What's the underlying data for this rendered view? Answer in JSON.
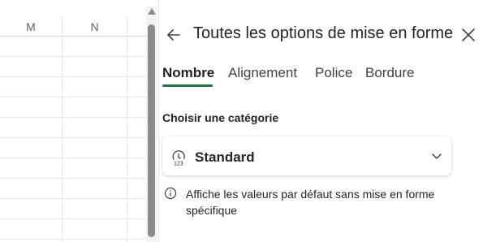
{
  "grid": {
    "columns": [
      "M",
      "N"
    ]
  },
  "pane": {
    "title": "Toutes les options de mise en forme",
    "back_icon": "arrow-left-icon",
    "close_icon": "close-icon",
    "tabs": [
      {
        "label": "Nombre",
        "active": true
      },
      {
        "label": "Alignement",
        "active": false
      },
      {
        "label": "Police",
        "active": false
      },
      {
        "label": "Bordure",
        "active": false
      }
    ],
    "section_label": "Choisir une catégorie",
    "category": {
      "value": "Standard",
      "icon": "clock-123-icon",
      "icon_text": "123"
    },
    "description": "Affiche les valeurs par défaut sans mise en forme spécifique",
    "accent_color": "#217346"
  }
}
